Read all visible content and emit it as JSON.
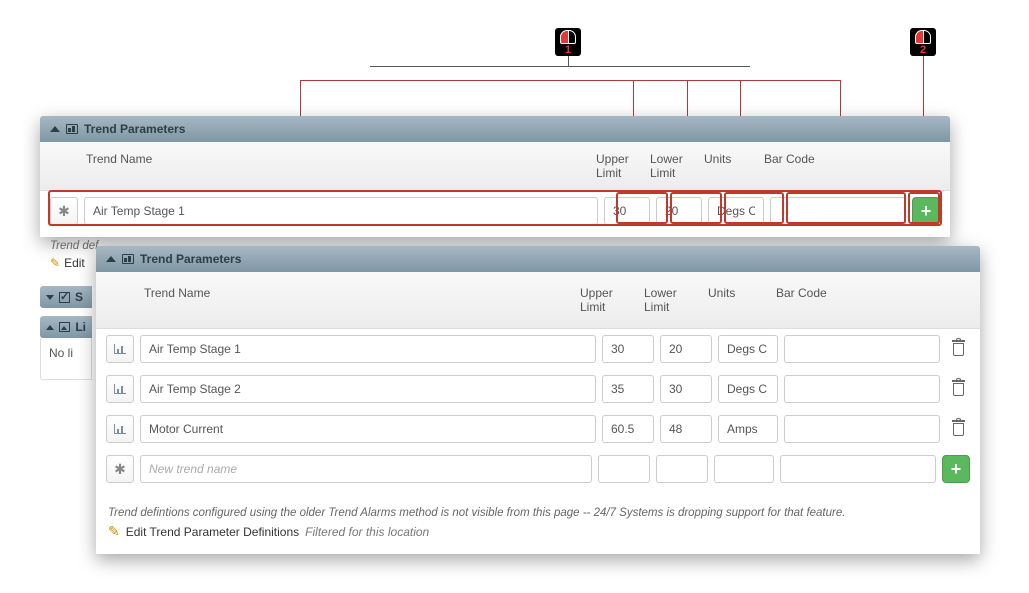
{
  "annotations": {
    "callout1": "1",
    "callout2": "2"
  },
  "panel1": {
    "title": "Trend Parameters",
    "headers": {
      "name": "Trend Name",
      "upper": "Upper Limit",
      "lower": "Lower Limit",
      "units": "Units",
      "barcode": "Bar Code"
    },
    "new_row": {
      "name": "Air Temp Stage 1",
      "upper": "30",
      "lower": "20",
      "units": "Degs C",
      "barcode": ""
    }
  },
  "between": {
    "note_prefix": "Trend def",
    "edit_prefix": "Edit"
  },
  "stubs": {
    "s_label": "S",
    "li_label": "Li",
    "body_text": "No li"
  },
  "panel2": {
    "title": "Trend Parameters",
    "headers": {
      "name": "Trend Name",
      "upper": "Upper Limit",
      "lower": "Lower Limit",
      "units": "Units",
      "barcode": "Bar Code"
    },
    "rows": [
      {
        "name": "Air Temp Stage 1",
        "upper": "30",
        "lower": "20",
        "units": "Degs C",
        "barcode": ""
      },
      {
        "name": "Air Temp Stage 2",
        "upper": "35",
        "lower": "30",
        "units": "Degs C",
        "barcode": ""
      },
      {
        "name": "Motor Current",
        "upper": "60.5",
        "lower": "48",
        "units": "Amps",
        "barcode": ""
      }
    ],
    "new_row_placeholder": "New trend name",
    "footer_note": "Trend defintions configured using the older Trend Alarms method is not visible from this page -- 24/7 Systems is dropping support for that feature.",
    "edit_link_text": "Edit Trend Parameter Definitions",
    "edit_link_suffix": "Filtered for this location"
  }
}
